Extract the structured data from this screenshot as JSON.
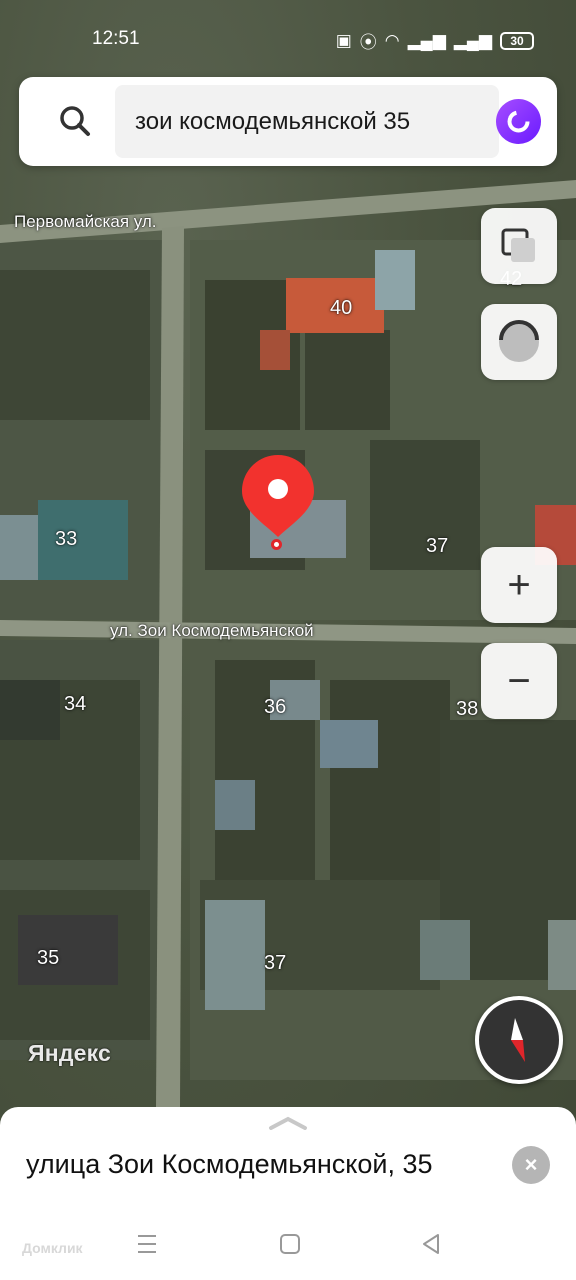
{
  "status_bar": {
    "time": "12:51",
    "battery": "30"
  },
  "search": {
    "query": "зои космодемьянской 35"
  },
  "map": {
    "streets": [
      "Первомайская ул.",
      "ул. Зои Космодемьянской"
    ],
    "houses": [
      "40",
      "42",
      "33",
      "37",
      "34",
      "36",
      "38",
      "35",
      "37"
    ],
    "logo": "Яндекс"
  },
  "controls": {
    "zoom_in": "+",
    "zoom_out": "−"
  },
  "sheet": {
    "title": "улица Зои Космодемьянской, 35",
    "close": "×"
  },
  "watermark": "Домклик"
}
